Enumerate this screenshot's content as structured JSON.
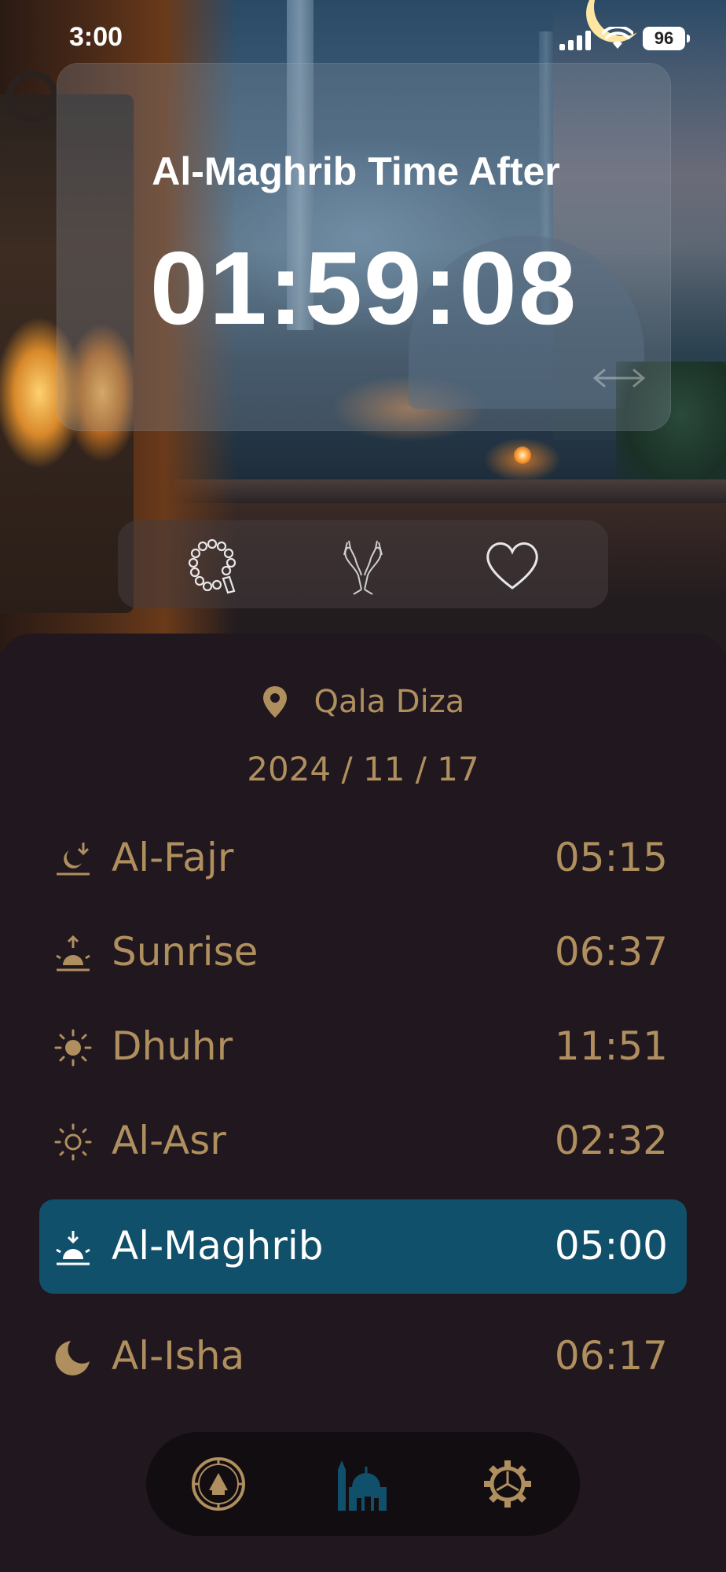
{
  "status_bar": {
    "time": "3:00",
    "battery": "96"
  },
  "countdown": {
    "label": "Al-Maghrib Time After",
    "timer": "01:59:08"
  },
  "quick_actions": [
    {
      "icon": "prayer-beads-icon"
    },
    {
      "icon": "praying-hands-icon"
    },
    {
      "icon": "heart-icon"
    }
  ],
  "location": {
    "name": "Qala Diza",
    "icon": "location-pin-icon"
  },
  "date": "2024 / 11 / 17",
  "prayers": [
    {
      "name": "Al-Fajr",
      "time": "05:15",
      "icon": "moon-dawn-icon",
      "active": false
    },
    {
      "name": "Sunrise",
      "time": "06:37",
      "icon": "sunrise-icon",
      "active": false
    },
    {
      "name": "Dhuhr",
      "time": "11:51",
      "icon": "sun-icon",
      "active": false
    },
    {
      "name": "Al-Asr",
      "time": "02:32",
      "icon": "sun-outline-icon",
      "active": false
    },
    {
      "name": "Al-Maghrib",
      "time": "05:00",
      "icon": "sunset-icon",
      "active": true
    },
    {
      "name": "Al-Isha",
      "time": "06:17",
      "icon": "crescent-moon-icon",
      "active": false
    }
  ],
  "bottom_nav": [
    {
      "icon": "qibla-compass-icon",
      "active": false
    },
    {
      "icon": "mosque-icon",
      "active": true
    },
    {
      "icon": "settings-gear-icon",
      "active": false
    }
  ],
  "colors": {
    "accent_gold": "#b08f5e",
    "active_row": "#11506a",
    "sheet_bg": "#20171f",
    "nav_active": "#11506a"
  }
}
